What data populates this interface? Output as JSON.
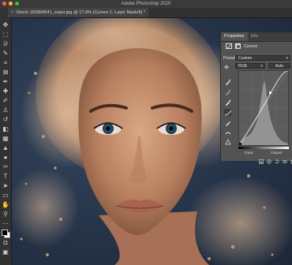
{
  "app": {
    "title": "Adobe Photoshop 2020"
  },
  "document": {
    "tab_label": "iStock-181894541_super.jpg @ 17,9% (Curves 1, Layer Mask/8) *",
    "close_glyph": "×"
  },
  "tools": [
    {
      "name": "move-tool-icon",
      "glyph": "✥"
    },
    {
      "name": "marquee-tool-icon",
      "glyph": "⬚"
    },
    {
      "name": "lasso-tool-icon",
      "glyph": "ᘐ"
    },
    {
      "name": "quick-select-tool-icon",
      "glyph": "✎"
    },
    {
      "name": "crop-tool-icon",
      "glyph": "⌗"
    },
    {
      "name": "frame-tool-icon",
      "glyph": "⊠"
    },
    {
      "name": "eyedropper-tool-icon",
      "glyph": "✒"
    },
    {
      "name": "healing-brush-tool-icon",
      "glyph": "✚"
    },
    {
      "name": "brush-tool-icon",
      "glyph": "✐"
    },
    {
      "name": "stamp-tool-icon",
      "glyph": "♙"
    },
    {
      "name": "history-brush-tool-icon",
      "glyph": "↺"
    },
    {
      "name": "eraser-tool-icon",
      "glyph": "◧"
    },
    {
      "name": "gradient-tool-icon",
      "glyph": "▦"
    },
    {
      "name": "blur-tool-icon",
      "glyph": "▲"
    },
    {
      "name": "dodge-tool-icon",
      "glyph": "●"
    },
    {
      "name": "pen-tool-icon",
      "glyph": "✑"
    },
    {
      "name": "type-tool-icon",
      "glyph": "T"
    },
    {
      "name": "path-select-tool-icon",
      "glyph": "➤"
    },
    {
      "name": "shape-tool-icon",
      "glyph": "▭"
    },
    {
      "name": "hand-tool-icon",
      "glyph": "✋"
    },
    {
      "name": "zoom-tool-icon",
      "glyph": "⚲"
    },
    {
      "name": "more-tools-icon",
      "glyph": "⋯"
    },
    {
      "name": "color-swatches-icon",
      "glyph": ""
    },
    {
      "name": "quick-mask-icon",
      "glyph": "◘"
    },
    {
      "name": "screen-mode-icon",
      "glyph": "▣"
    }
  ],
  "properties": {
    "tabs": [
      "Properties",
      "Info"
    ],
    "adjustment_name": "Curves",
    "preset_label": "Preset:",
    "preset_value": "Custom",
    "channel_value": "RGB",
    "auto_label": "Auto",
    "input_label": "Input:",
    "output_label": "Output:"
  },
  "colors": {
    "accent": "#1473e6",
    "panel": "#535353",
    "traffic_close": "#ff5f57",
    "traffic_min": "#febc2e",
    "traffic_max": "#28c840"
  }
}
